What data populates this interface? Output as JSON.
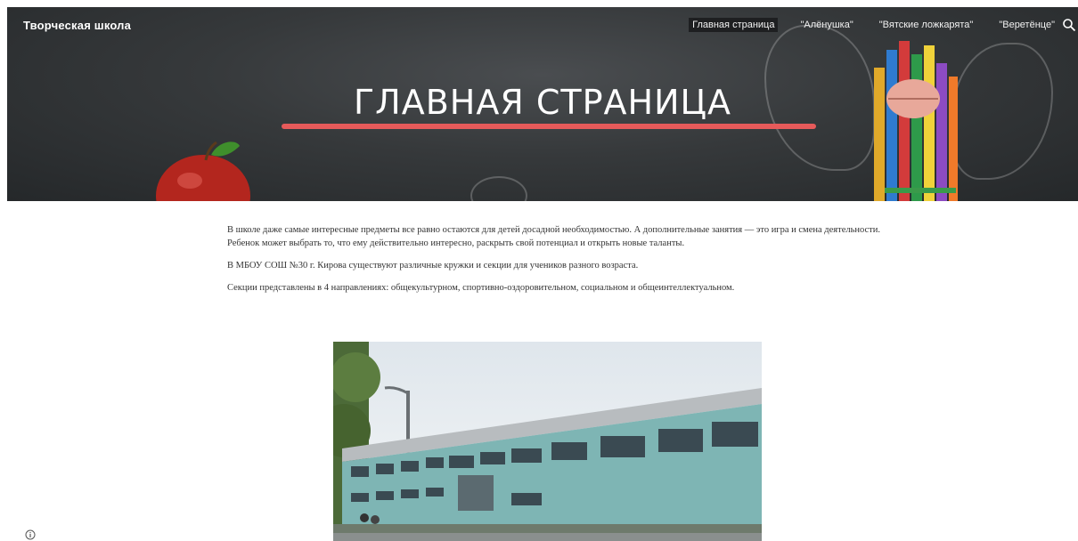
{
  "header": {
    "site_title": "Творческая школа",
    "page_title": "ГЛАВНАЯ СТРАНИЦА"
  },
  "nav": {
    "items": [
      {
        "label": "Главная страница",
        "active": true
      },
      {
        "label": "\"Алёнушка\"",
        "active": false
      },
      {
        "label": "\"Вятские ложкарята\"",
        "active": false
      },
      {
        "label": "\"Веретёнце\"",
        "active": false
      }
    ],
    "search_icon": "search-icon"
  },
  "content": {
    "paragraphs": [
      "В школе даже самые интересные предметы все равно остаются для детей досадной необходимостью. А дополнительные занятия — это игра и смена деятельности. Ребенок может выбрать то, что ему действительно интересно, раскрыть свой потенциал и открыть новые таланты.",
      "В МБОУ СОШ №30 г. Кирова существуют различные кружки и секции для учеников разного возраста.",
      "Секции представлены в 4 направлениях: общекультурном, спортивно-оздоровительном, социальном и общеинтеллектуальном."
    ]
  },
  "colors": {
    "accent_underline": "#e65a5a",
    "nav_active_bg": "#1e1f21",
    "banner": "#36393b"
  }
}
